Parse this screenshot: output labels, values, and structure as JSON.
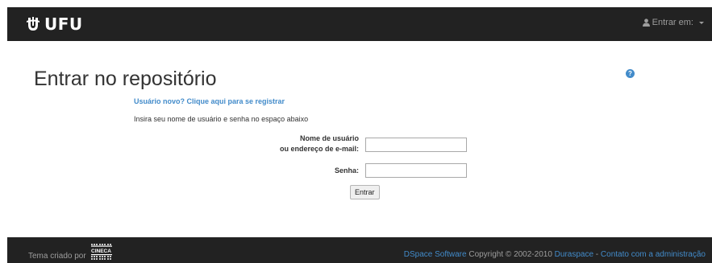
{
  "header": {
    "logo_text": "UFU",
    "login_label": "Entrar em:"
  },
  "main": {
    "title": "Entrar no repositório",
    "register_link": "Usuário novo? Clique aqui para se registrar",
    "instructions": "Insira seu nome de usuário e senha no espaço abaixo",
    "username_label_line1": "Nome de usuário",
    "username_label_line2": "ou endereço de e-mail:",
    "username_value": "",
    "password_label": "Senha:",
    "password_value": "",
    "submit_label": "Entrar",
    "help_icon": "?"
  },
  "footer": {
    "theme_text": "Tema criado por",
    "cineca_logo_text": "CINECA",
    "dspace_link": "DSpace Software",
    "copyright_text": " Copyright © 2002-2010 ",
    "duraspace_link": "Duraspace",
    "separator": " - ",
    "contact_link": "Contato com a administração"
  },
  "colors": {
    "navbar_bg": "#222222",
    "link": "#428bca",
    "muted_text": "#9d9d9d"
  },
  "icons": {
    "logo": "ufu-logo-icon",
    "user": "user-icon",
    "caret": "caret-down-icon",
    "help": "question-circle-icon"
  }
}
